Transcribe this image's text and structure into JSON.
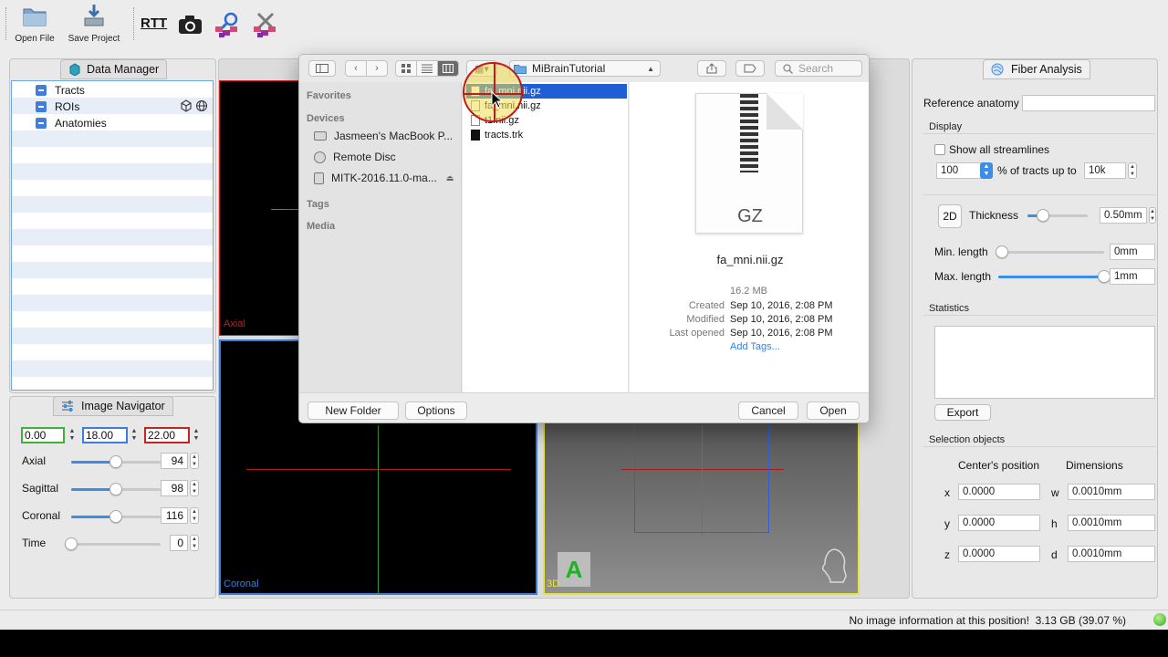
{
  "toolbar": {
    "open_file": "Open File",
    "save_project": "Save Project",
    "rtt": "RTT"
  },
  "data_manager": {
    "tab": "Data Manager",
    "items": [
      "Tracts",
      "ROIs",
      "Anatomies"
    ]
  },
  "image_navigator": {
    "tab": "Image Navigator",
    "coords": [
      "0.00",
      "18.00",
      "22.00"
    ],
    "rows": [
      {
        "label": "Axial",
        "value": "94",
        "position": 0.5
      },
      {
        "label": "Sagittal",
        "value": "98",
        "position": 0.5
      },
      {
        "label": "Coronal",
        "value": "116",
        "position": 0.5
      },
      {
        "label": "Time",
        "value": "0",
        "position": 0.0
      }
    ]
  },
  "views": {
    "axial_label": "Axial",
    "coronal_label": "Coronal",
    "threed_label": "3D",
    "orientation_marker": "A"
  },
  "dialog": {
    "folder": "MiBrainTutorial",
    "search_placeholder": "Search",
    "sidebar": {
      "favorites": "Favorites",
      "devices": "Devices",
      "device_items": [
        "Jasmeen's MacBook P...",
        "Remote Disc",
        "MITK-2016.11.0-ma..."
      ],
      "tags": "Tags",
      "media": "Media"
    },
    "files": [
      "fa_mni.nii.gz",
      "fa_mni.nii.gz",
      "t1.nii.gz",
      "tracts.trk"
    ],
    "preview": {
      "thumb_label": "GZ",
      "filename": "fa_mni.nii.gz",
      "size": "16.2 MB",
      "created_label": "Created",
      "created": "Sep 10, 2016, 2:08 PM",
      "modified_label": "Modified",
      "modified": "Sep 10, 2016, 2:08 PM",
      "opened_label": "Last opened",
      "opened": "Sep 10, 2016, 2:08 PM",
      "add_tags": "Add Tags..."
    },
    "new_folder": "New Folder",
    "options": "Options",
    "cancel": "Cancel",
    "open": "Open"
  },
  "fiber": {
    "tab": "Fiber Analysis",
    "reference_anatomy": "Reference anatomy",
    "display": "Display",
    "show_all": "Show all streamlines",
    "percent_value": "100",
    "percent_label": "% of tracts up to",
    "up_to_value": "10k",
    "mode_2d": "2D",
    "thickness": "Thickness",
    "thickness_value": "0.50mm",
    "thickness_position": 0.25,
    "min_length": "Min. length",
    "min_value": "0mm",
    "min_position": 0.0,
    "max_length": "Max. length",
    "max_value": "1mm",
    "max_position": 1.0,
    "statistics": "Statistics",
    "export": "Export",
    "selection_objects": "Selection objects",
    "centers_position": "Center's position",
    "dimensions": "Dimensions",
    "x_label": "x",
    "y_label": "y",
    "z_label": "z",
    "w_label": "w",
    "h_label": "h",
    "d_label": "d",
    "x_value": "0.0000",
    "y_value": "0.0000",
    "z_value": "0.0000",
    "w_value": "0.0010mm",
    "h_value": "0.0010mm",
    "d_value": "0.0010mm"
  },
  "status": {
    "message": "No image information at this position!",
    "memory": "3.13 GB (39.07 %)"
  },
  "colors": {
    "accent": "#3d8de6",
    "selection": "#1e5fd6",
    "axial_border": "#d02020",
    "coronal_border": "#3a7fe0",
    "threed_border": "#e6e63a"
  }
}
